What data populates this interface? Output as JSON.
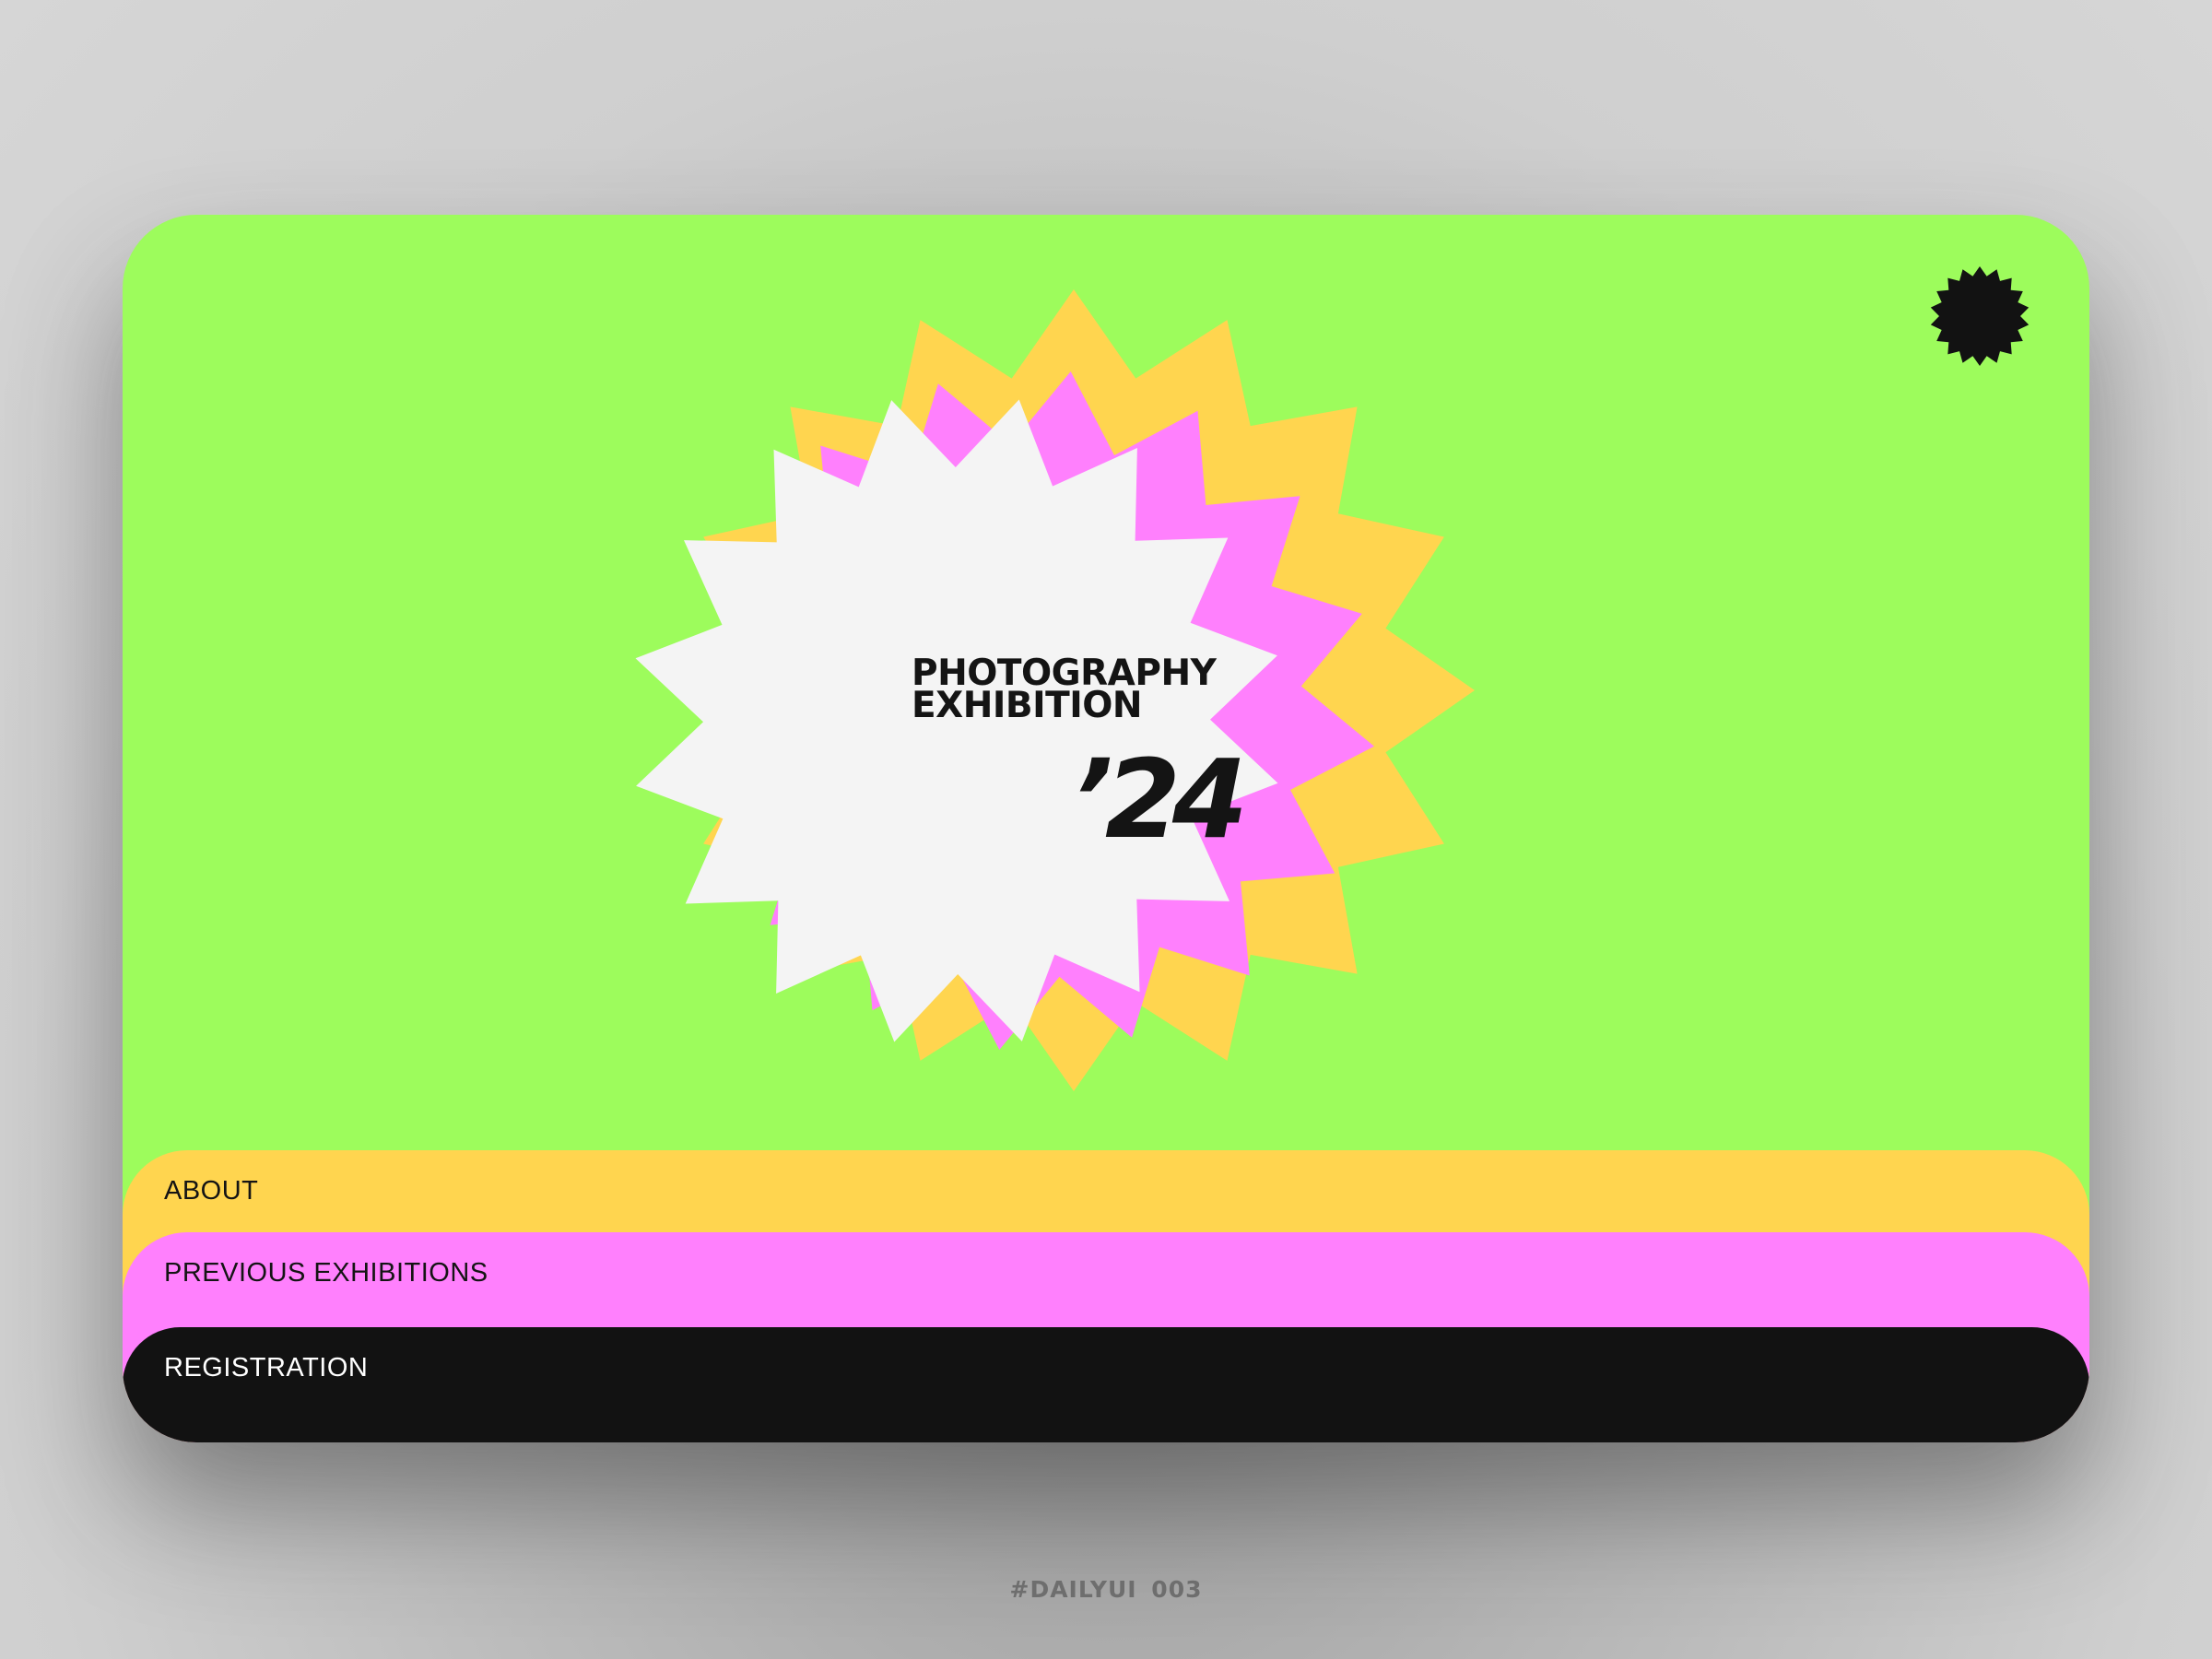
{
  "hero": {
    "title_line1": "PHOTOGRAPHY",
    "title_line2": "EXHIBITION",
    "year": "’24"
  },
  "colors": {
    "background": "#9dfc5c",
    "yellow": "#ffd54f",
    "pink": "#ff80fd",
    "white": "#f4f4f4",
    "black": "#121212"
  },
  "icons": {
    "corner": "starburst-badge-icon"
  },
  "menu": [
    {
      "label": "ABOUT"
    },
    {
      "label": "PREVIOUS EXHIBITIONS"
    },
    {
      "label": "REGISTRATION"
    }
  ],
  "footer": {
    "caption": "#DAILYUI   003"
  }
}
